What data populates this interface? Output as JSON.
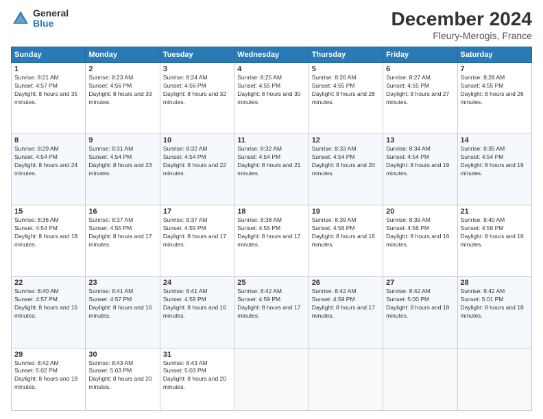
{
  "header": {
    "logo_general": "General",
    "logo_blue": "Blue",
    "month_title": "December 2024",
    "location": "Fleury-Merogis, France"
  },
  "weekdays": [
    "Sunday",
    "Monday",
    "Tuesday",
    "Wednesday",
    "Thursday",
    "Friday",
    "Saturday"
  ],
  "weeks": [
    [
      {
        "day": "1",
        "sunrise": "Sunrise: 8:21 AM",
        "sunset": "Sunset: 4:57 PM",
        "daylight": "Daylight: 8 hours and 35 minutes."
      },
      {
        "day": "2",
        "sunrise": "Sunrise: 8:23 AM",
        "sunset": "Sunset: 4:56 PM",
        "daylight": "Daylight: 8 hours and 33 minutes."
      },
      {
        "day": "3",
        "sunrise": "Sunrise: 8:24 AM",
        "sunset": "Sunset: 4:56 PM",
        "daylight": "Daylight: 8 hours and 32 minutes."
      },
      {
        "day": "4",
        "sunrise": "Sunrise: 8:25 AM",
        "sunset": "Sunset: 4:55 PM",
        "daylight": "Daylight: 8 hours and 30 minutes."
      },
      {
        "day": "5",
        "sunrise": "Sunrise: 8:26 AM",
        "sunset": "Sunset: 4:55 PM",
        "daylight": "Daylight: 8 hours and 28 minutes."
      },
      {
        "day": "6",
        "sunrise": "Sunrise: 8:27 AM",
        "sunset": "Sunset: 4:55 PM",
        "daylight": "Daylight: 8 hours and 27 minutes."
      },
      {
        "day": "7",
        "sunrise": "Sunrise: 8:28 AM",
        "sunset": "Sunset: 4:55 PM",
        "daylight": "Daylight: 8 hours and 26 minutes."
      }
    ],
    [
      {
        "day": "8",
        "sunrise": "Sunrise: 8:29 AM",
        "sunset": "Sunset: 4:54 PM",
        "daylight": "Daylight: 8 hours and 24 minutes."
      },
      {
        "day": "9",
        "sunrise": "Sunrise: 8:31 AM",
        "sunset": "Sunset: 4:54 PM",
        "daylight": "Daylight: 8 hours and 23 minutes."
      },
      {
        "day": "10",
        "sunrise": "Sunrise: 8:32 AM",
        "sunset": "Sunset: 4:54 PM",
        "daylight": "Daylight: 8 hours and 22 minutes."
      },
      {
        "day": "11",
        "sunrise": "Sunrise: 8:32 AM",
        "sunset": "Sunset: 4:54 PM",
        "daylight": "Daylight: 8 hours and 21 minutes."
      },
      {
        "day": "12",
        "sunrise": "Sunrise: 8:33 AM",
        "sunset": "Sunset: 4:54 PM",
        "daylight": "Daylight: 8 hours and 20 minutes."
      },
      {
        "day": "13",
        "sunrise": "Sunrise: 8:34 AM",
        "sunset": "Sunset: 4:54 PM",
        "daylight": "Daylight: 8 hours and 19 minutes."
      },
      {
        "day": "14",
        "sunrise": "Sunrise: 8:35 AM",
        "sunset": "Sunset: 4:54 PM",
        "daylight": "Daylight: 8 hours and 19 minutes."
      }
    ],
    [
      {
        "day": "15",
        "sunrise": "Sunrise: 8:36 AM",
        "sunset": "Sunset: 4:54 PM",
        "daylight": "Daylight: 8 hours and 18 minutes."
      },
      {
        "day": "16",
        "sunrise": "Sunrise: 8:37 AM",
        "sunset": "Sunset: 4:55 PM",
        "daylight": "Daylight: 8 hours and 17 minutes."
      },
      {
        "day": "17",
        "sunrise": "Sunrise: 8:37 AM",
        "sunset": "Sunset: 4:55 PM",
        "daylight": "Daylight: 8 hours and 17 minutes."
      },
      {
        "day": "18",
        "sunrise": "Sunrise: 8:38 AM",
        "sunset": "Sunset: 4:55 PM",
        "daylight": "Daylight: 8 hours and 17 minutes."
      },
      {
        "day": "19",
        "sunrise": "Sunrise: 8:39 AM",
        "sunset": "Sunset: 4:56 PM",
        "daylight": "Daylight: 8 hours and 16 minutes."
      },
      {
        "day": "20",
        "sunrise": "Sunrise: 8:39 AM",
        "sunset": "Sunset: 4:56 PM",
        "daylight": "Daylight: 8 hours and 16 minutes."
      },
      {
        "day": "21",
        "sunrise": "Sunrise: 8:40 AM",
        "sunset": "Sunset: 4:56 PM",
        "daylight": "Daylight: 8 hours and 16 minutes."
      }
    ],
    [
      {
        "day": "22",
        "sunrise": "Sunrise: 8:40 AM",
        "sunset": "Sunset: 4:57 PM",
        "daylight": "Daylight: 8 hours and 16 minutes."
      },
      {
        "day": "23",
        "sunrise": "Sunrise: 8:41 AM",
        "sunset": "Sunset: 4:57 PM",
        "daylight": "Daylight: 8 hours and 16 minutes."
      },
      {
        "day": "24",
        "sunrise": "Sunrise: 8:41 AM",
        "sunset": "Sunset: 4:58 PM",
        "daylight": "Daylight: 8 hours and 16 minutes."
      },
      {
        "day": "25",
        "sunrise": "Sunrise: 8:42 AM",
        "sunset": "Sunset: 4:59 PM",
        "daylight": "Daylight: 8 hours and 17 minutes."
      },
      {
        "day": "26",
        "sunrise": "Sunrise: 8:42 AM",
        "sunset": "Sunset: 4:59 PM",
        "daylight": "Daylight: 8 hours and 17 minutes."
      },
      {
        "day": "27",
        "sunrise": "Sunrise: 8:42 AM",
        "sunset": "Sunset: 5:00 PM",
        "daylight": "Daylight: 8 hours and 18 minutes."
      },
      {
        "day": "28",
        "sunrise": "Sunrise: 8:42 AM",
        "sunset": "Sunset: 5:01 PM",
        "daylight": "Daylight: 8 hours and 18 minutes."
      }
    ],
    [
      {
        "day": "29",
        "sunrise": "Sunrise: 8:42 AM",
        "sunset": "Sunset: 5:02 PM",
        "daylight": "Daylight: 8 hours and 19 minutes."
      },
      {
        "day": "30",
        "sunrise": "Sunrise: 8:43 AM",
        "sunset": "Sunset: 5:03 PM",
        "daylight": "Daylight: 8 hours and 20 minutes."
      },
      {
        "day": "31",
        "sunrise": "Sunrise: 8:43 AM",
        "sunset": "Sunset: 5:03 PM",
        "daylight": "Daylight: 8 hours and 20 minutes."
      },
      null,
      null,
      null,
      null
    ]
  ]
}
